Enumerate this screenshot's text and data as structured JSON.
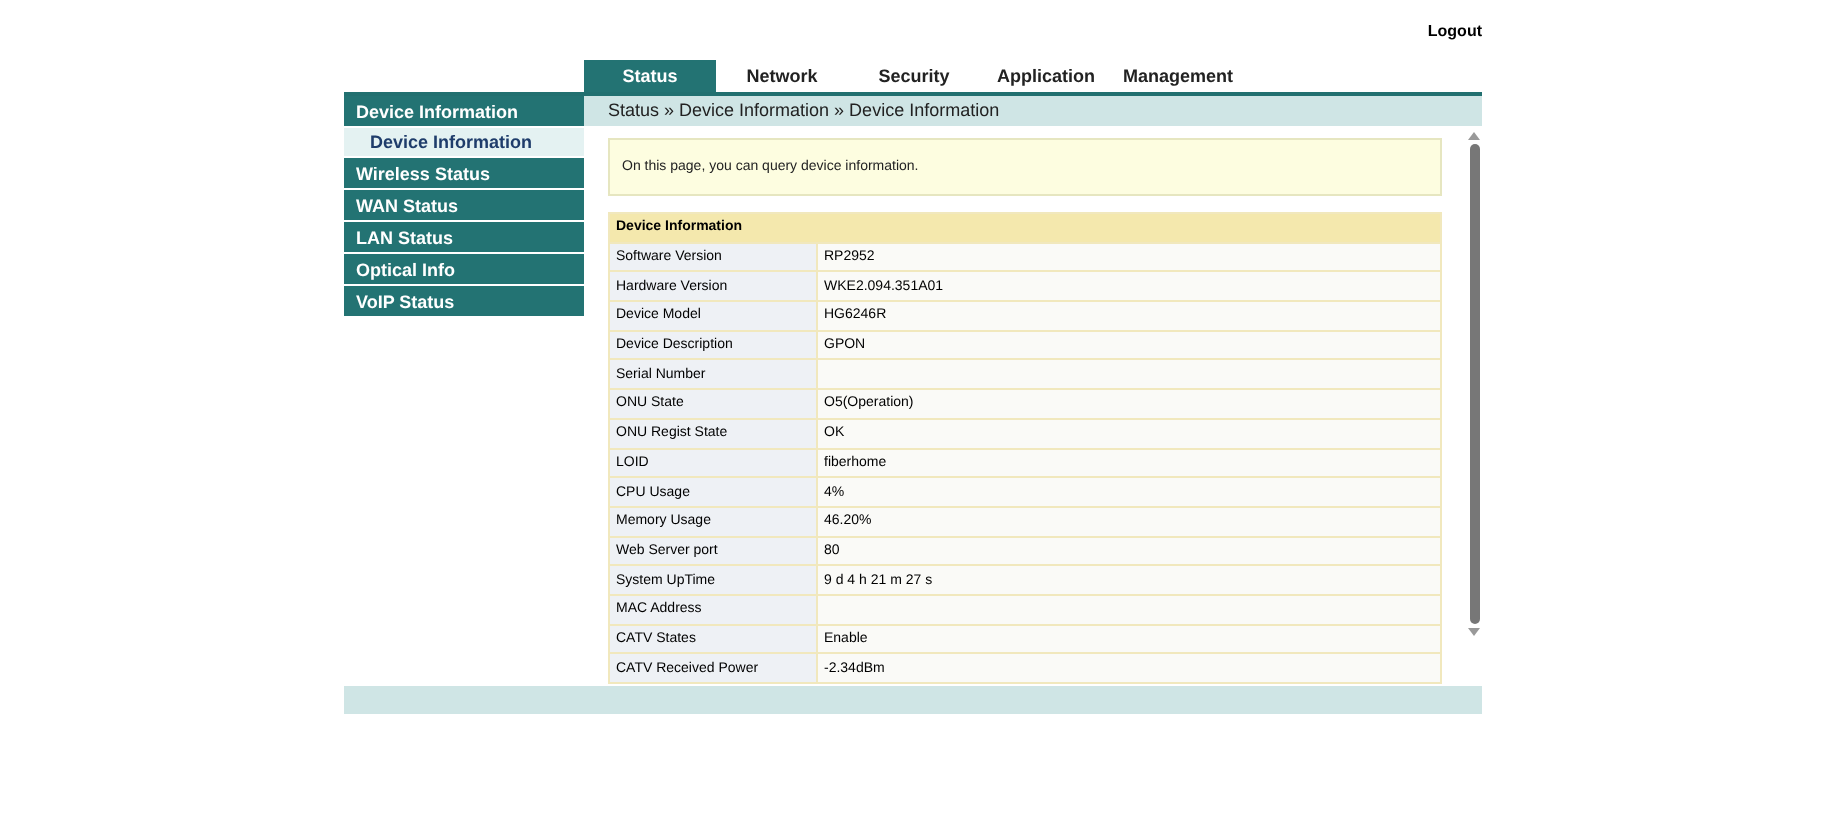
{
  "header": {
    "logout": "Logout"
  },
  "tabs": [
    {
      "label": "Status",
      "selected": true
    },
    {
      "label": "Network",
      "selected": false
    },
    {
      "label": "Security",
      "selected": false
    },
    {
      "label": "Application",
      "selected": false
    },
    {
      "label": "Management",
      "selected": false
    }
  ],
  "breadcrumb": "Status » Device Information » Device Information",
  "sidebar": {
    "items": [
      {
        "label": "Device Information",
        "children": [
          {
            "label": "Device Information",
            "selected": true
          }
        ]
      },
      {
        "label": "Wireless Status"
      },
      {
        "label": "WAN Status"
      },
      {
        "label": "LAN Status"
      },
      {
        "label": "Optical Info"
      },
      {
        "label": "VoIP Status"
      }
    ]
  },
  "notice": "On this page, you can query device information.",
  "table": {
    "title": "Device Information",
    "rows": [
      {
        "label": "Software Version",
        "value": "RP2952"
      },
      {
        "label": "Hardware Version",
        "value": "WKE2.094.351A01"
      },
      {
        "label": "Device Model",
        "value": "HG6246R"
      },
      {
        "label": "Device Description",
        "value": "GPON"
      },
      {
        "label": "Serial Number"
      },
      {
        "label": "ONU State",
        "value": "O5(Operation)"
      },
      {
        "label": "ONU Regist State",
        "value": "OK"
      },
      {
        "label": "LOID",
        "value": "fiberhome"
      },
      {
        "label": "CPU Usage",
        "value": "4%"
      },
      {
        "label": "Memory Usage",
        "value": "46.20%"
      },
      {
        "label": "Web Server port",
        "value": "80"
      },
      {
        "label": "System UpTime",
        "value": "9 d 4 h 21 m 27 s"
      },
      {
        "label": "MAC Address"
      },
      {
        "label": "CATV States",
        "value": "Enable"
      },
      {
        "label": "CATV Received Power",
        "value": "-2.34dBm"
      }
    ]
  }
}
